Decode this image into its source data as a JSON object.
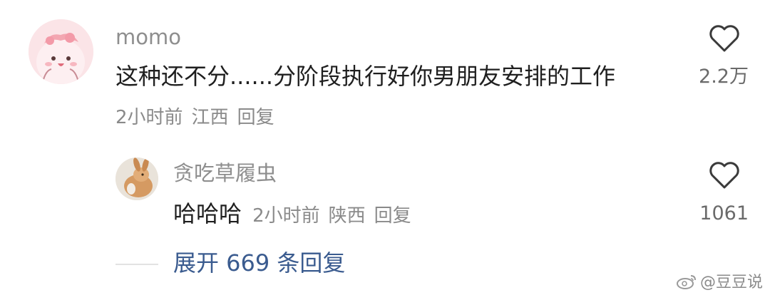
{
  "comment": {
    "username": "momo",
    "text": "这种还不分......分阶段执行好你男朋友安排的工作",
    "time": "2小时前",
    "location": "江西",
    "reply_label": "回复",
    "like_count": "2.2万"
  },
  "reply": {
    "username": "贪吃草履虫",
    "text": "哈哈哈",
    "time": "2小时前",
    "location": "陕西",
    "reply_label": "回复",
    "like_count": "1061"
  },
  "expand_label": "展开 669 条回复",
  "watermark": "@豆豆说",
  "colors": {
    "text_primary": "#1f1f1f",
    "text_secondary": "#8a8a8a",
    "link": "#3a5b8f",
    "avatar_main_bg": "#fbe4e7"
  },
  "icons": {
    "like": "heart-outline-icon",
    "watermark_logo": "weibo-logo-icon"
  }
}
